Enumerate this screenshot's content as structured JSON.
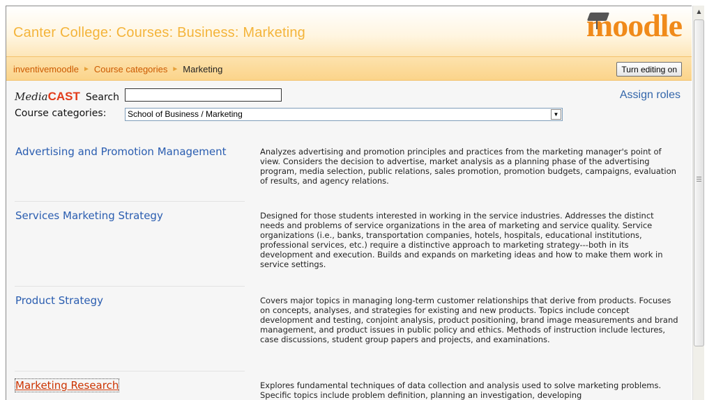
{
  "header": {
    "site_title": "Canter College: Courses: Business: Marketing",
    "logo_text": "moodle"
  },
  "navbar": {
    "breadcrumb": [
      "inventivemoodle",
      "Course categories",
      "Marketing"
    ],
    "edit_button": "Turn editing on"
  },
  "search": {
    "brand_media": "Media",
    "brand_cast": "CAST",
    "label": "Search",
    "value": ""
  },
  "assign_roles": "Assign roles",
  "categories": {
    "label": "Course categories:",
    "selected": "School of Business / Marketing"
  },
  "courses": [
    {
      "name": "Advertising and Promotion Management",
      "description": "Analyzes advertising and promotion principles and practices from the marketing manager's point of view. Considers the decision to advertise, market analysis as a planning phase of the advertising program, media selection, public relations, sales promotion, promotion budgets, campaigns, evaluation of results, and agency relations."
    },
    {
      "name": "Services Marketing Strategy",
      "description": "Designed for those students interested in working in the service industries. Addresses the distinct needs and problems of service organizations in the area of marketing and service quality. Service organizations (i.e., banks, transportation companies, hotels, hospitals, educational institutions, professional services, etc.) require a distinctive approach to marketing strategy---both in its development and execution. Builds and expands on marketing ideas and how to make them work in service settings."
    },
    {
      "name": "Product Strategy",
      "description": "Covers major topics in managing long-term customer relationships that derive from products. Focuses on concepts, analyses, and strategies for existing and new products. Topics include concept development and testing, conjoint analysis, product positioning, brand image measurements and brand management, and product issues in public policy and ethics. Methods of instruction include lectures, case discussions, student group papers and projects, and examinations."
    },
    {
      "name": "Marketing Research",
      "description": "Explores fundamental techniques of data collection and analysis used to solve marketing problems. Specific topics include problem definition, planning an investigation, developing"
    }
  ],
  "colors": {
    "accent_orange": "#f08a1a",
    "link_blue": "#2a5db0",
    "hover_red": "#cc3300"
  }
}
